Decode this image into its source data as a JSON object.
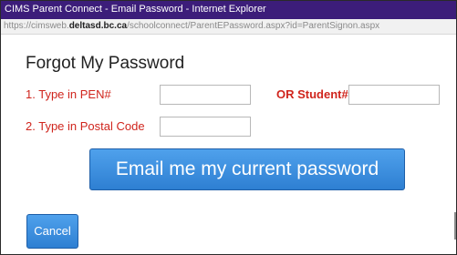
{
  "window": {
    "title": "CIMS Parent Connect - Email Password - Internet Explorer"
  },
  "address": {
    "prefix": "https://cimsweb.",
    "host": "deltasd.bc.ca",
    "path": "/schoolconnect/ParentEPassword.aspx?id=ParentSignon.aspx"
  },
  "form": {
    "heading": "Forgot My Password",
    "pen_label": "1. Type in PEN#",
    "pen_value": "",
    "or_label": "OR Student#",
    "student_value": "",
    "postal_label": "2. Type in Postal Code",
    "postal_value": "",
    "email_button": "Email me my current password",
    "cancel_button": "Cancel"
  },
  "colors": {
    "titlebar": "#3c1d7a",
    "label_red": "#d0251d",
    "button_blue": "#2e7fd2"
  }
}
